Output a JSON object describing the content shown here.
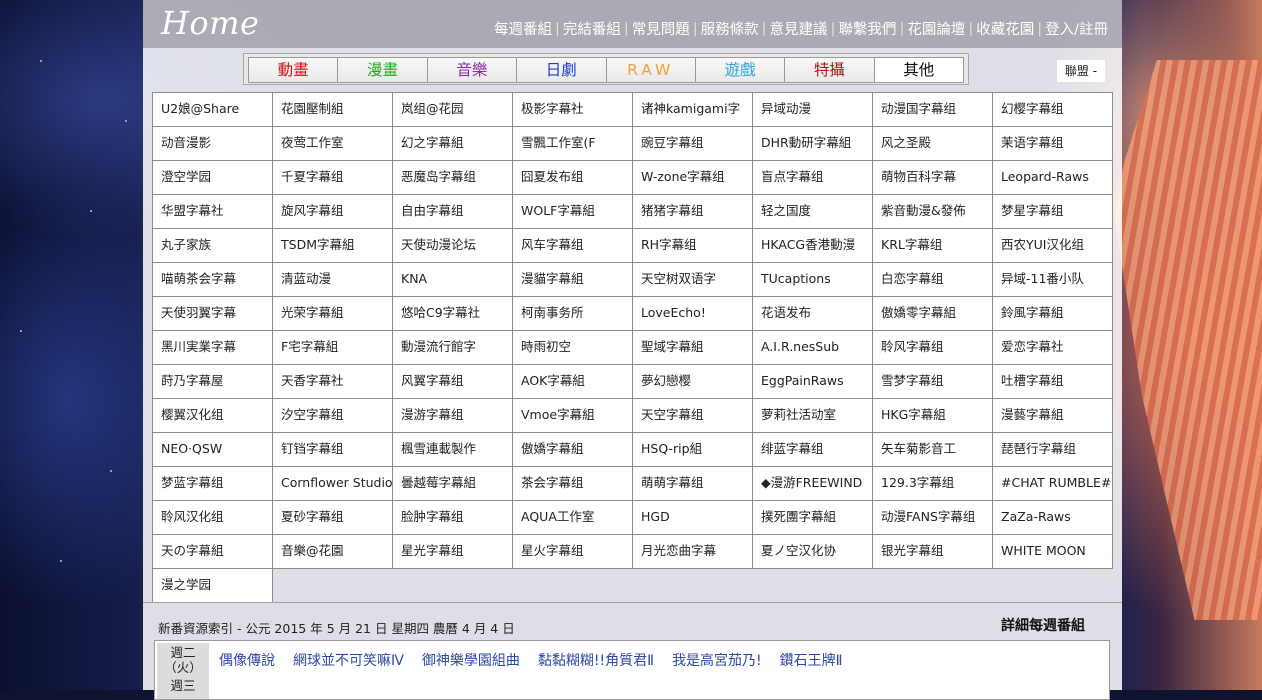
{
  "site": {
    "logo": "Home"
  },
  "topnav": [
    "每週番組",
    "完結番組",
    "常見問題",
    "服務條款",
    "意見建議",
    "聯繫我們",
    "花園論壇",
    "收藏花園",
    "登入/註冊"
  ],
  "tabs": [
    {
      "label": "動畫",
      "color": "#cc1111"
    },
    {
      "label": "漫畫",
      "color": "#22aa22"
    },
    {
      "label": "音樂",
      "color": "#8a2ca8"
    },
    {
      "label": "日劇",
      "color": "#1c3ccf"
    },
    {
      "label": "RAW",
      "color": "#f0a040"
    },
    {
      "label": "遊戲",
      "color": "#2aa8d8"
    },
    {
      "label": "特攝",
      "color": "#b01818"
    },
    {
      "label": "其他",
      "color": "#111111"
    }
  ],
  "union_button": "聯盟 -",
  "groups": [
    "U2娘@Share",
    "花園壓制組",
    "岚组@花园",
    "极影字幕社",
    "诸神kamigami字",
    "异域动漫",
    "动漫国字幕组",
    "幻樱字幕组",
    "动音漫影",
    "夜莺工作室",
    "幻之字幕組",
    "雪飄工作室(F",
    "豌豆字幕组",
    "DHR動研字幕組",
    "风之圣殿",
    "茉语字幕组",
    "澄空学园",
    "千夏字幕组",
    "恶魔岛字幕组",
    "囧夏发布组",
    "W-zone字幕组",
    "盲点字幕组",
    "萌物百科字幕",
    "Leopard-Raws",
    "华盟字幕社",
    "旋风字幕组",
    "自由字幕组",
    "WOLF字幕組",
    "猪猪字幕组",
    "轻之国度",
    "紫音動漫&發佈",
    "梦星字幕组",
    "丸子家族",
    "TSDM字幕組",
    "天使动漫论坛",
    "风车字幕组",
    "RH字幕组",
    "HKACG香港動漫",
    "KRL字幕组",
    "西农YUI汉化组",
    "喵萌茶会字幕",
    "清蓝动漫",
    "KNA",
    "漫貓字幕組",
    "天空树双语字",
    "TUcaptions",
    "白恋字幕组",
    "异域-11番小队",
    "天使羽翼字幕",
    "光荣字幕組",
    "悠哈C9字幕社",
    "柯南事务所",
    "LoveEcho!",
    "花语发布",
    "傲嬌零字幕組",
    "鈴風字幕組",
    "黑川実業字幕",
    "F宅字幕組",
    "動漫流行館字",
    "時雨初空",
    "聖域字幕組",
    "A.I.R.nesSub",
    "聆风字幕组",
    "爱恋字幕社",
    "莳乃字幕屋",
    "天香字幕社",
    "风翼字幕组",
    "AOK字幕組",
    "夢幻戀樱",
    "EggPainRaws",
    "雪梦字幕组",
    "吐槽字幕组",
    "樱翼汉化组",
    "汐空字幕组",
    "漫游字幕组",
    "Vmoe字幕組",
    "天空字幕组",
    "萝莉社活动室",
    "HKG字幕組",
    "漫藝字幕組",
    "NEO·QSW",
    "钉铛字幕组",
    "楓雪連載製作",
    "傲嬌字幕組",
    "HSQ-rip組",
    "绯蓝字幕组",
    "矢车菊影音工",
    "琵琶行字幕组",
    "梦蓝字幕组",
    "Cornflower Studio",
    "曇越莓字幕組",
    "茶会字幕组",
    "萌萌字幕组",
    "◆漫游FREEWIND",
    "129.3字幕组",
    "#CHAT RUMBLE#",
    "聆风汉化组",
    "夏砂字幕组",
    "脸肿字幕组",
    "AQUA工作室",
    "HGD",
    "撲死團字幕組",
    "动漫FANS字幕组",
    "ZaZa-Raws",
    "天の字幕組",
    "音樂@花園",
    "星光字幕组",
    "星火字幕组",
    "月光恋曲字幕",
    "夏ノ空汉化协",
    "银光字幕组",
    "WHITE MOON",
    "漫之学园"
  ],
  "schedule": {
    "title": "新番資源索引 - 公元 2015 年 5 月 21 日 星期四 農曆 4 月 4 日",
    "more_link": "詳細每週番組",
    "days": [
      {
        "label": "週二",
        "sub": "（火）",
        "shows": [
          "偶像傳說",
          "網球並不可笑嘛Ⅳ",
          "御神樂學園組曲",
          "黏黏糊糊!!角質君Ⅱ",
          "我是高宮茄乃!",
          "鑽石王牌Ⅱ"
        ]
      },
      {
        "label": "週三"
      }
    ]
  }
}
